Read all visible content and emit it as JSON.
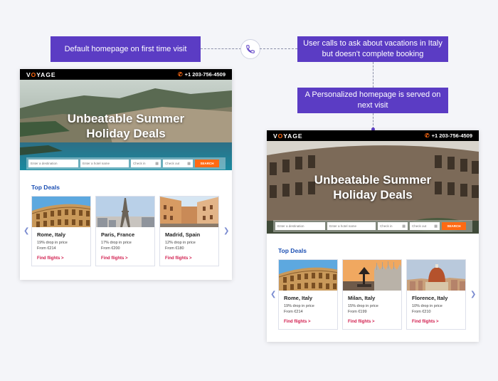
{
  "callouts": {
    "default": "Default homepage on first time visit",
    "call": "User calls to ask about vacations in Italy but doesn't complete booking",
    "personalized": "A Personalized homepage is served on next visit"
  },
  "colors": {
    "callout": "#5b3cc4",
    "accent": "#ff6a13",
    "deals_title": "#1b4fb3",
    "flights_link": "#d11c4d"
  },
  "sites": [
    {
      "brand": "VOYAGE",
      "phone": "+1 203-756-4509",
      "hero_title_line1": "Unbeatable Summer",
      "hero_title_line2": "Holiday Deals",
      "search": {
        "destination_placeholder": "Enter a destination",
        "hotel_placeholder": "Enter a hotel name",
        "check_in": "Check in",
        "check_out": "Check out",
        "button": "SEARCH"
      },
      "deals_title": "Top Deals",
      "deals": [
        {
          "city": "Rome, Italy",
          "drop": "19% drop in price",
          "from": "From €214",
          "link": "Find flights >",
          "image": "colosseum"
        },
        {
          "city": "Paris, France",
          "drop": "17% drop in price",
          "from": "From €200",
          "link": "Find flights >",
          "image": "eiffel-tower"
        },
        {
          "city": "Madrid, Spain",
          "drop": "12% drop in price",
          "from": "From €180",
          "link": "Find flights >",
          "image": "madrid-street"
        }
      ]
    },
    {
      "brand": "VOYAGE",
      "phone": "+1 203-756-4509",
      "hero_title_line1": "Unbeatable Summer",
      "hero_title_line2": "Holiday Deals",
      "search": {
        "destination_placeholder": "Enter a destination",
        "hotel_placeholder": "Enter a hotel name",
        "check_in": "Check in",
        "check_out": "Check out",
        "button": "SEARCH"
      },
      "deals_title": "Top Deals",
      "deals": [
        {
          "city": "Rome, Italy",
          "drop": "19% drop in price",
          "from": "From €214",
          "link": "Find flights >",
          "image": "colosseum"
        },
        {
          "city": "Milan, Italy",
          "drop": "15% drop in price",
          "from": "From €199",
          "link": "Find flights >",
          "image": "milan-cathedral"
        },
        {
          "city": "Florence, Italy",
          "drop": "10% drop in price",
          "from": "From €210",
          "link": "Find flights >",
          "image": "florence-dome"
        }
      ]
    }
  ]
}
